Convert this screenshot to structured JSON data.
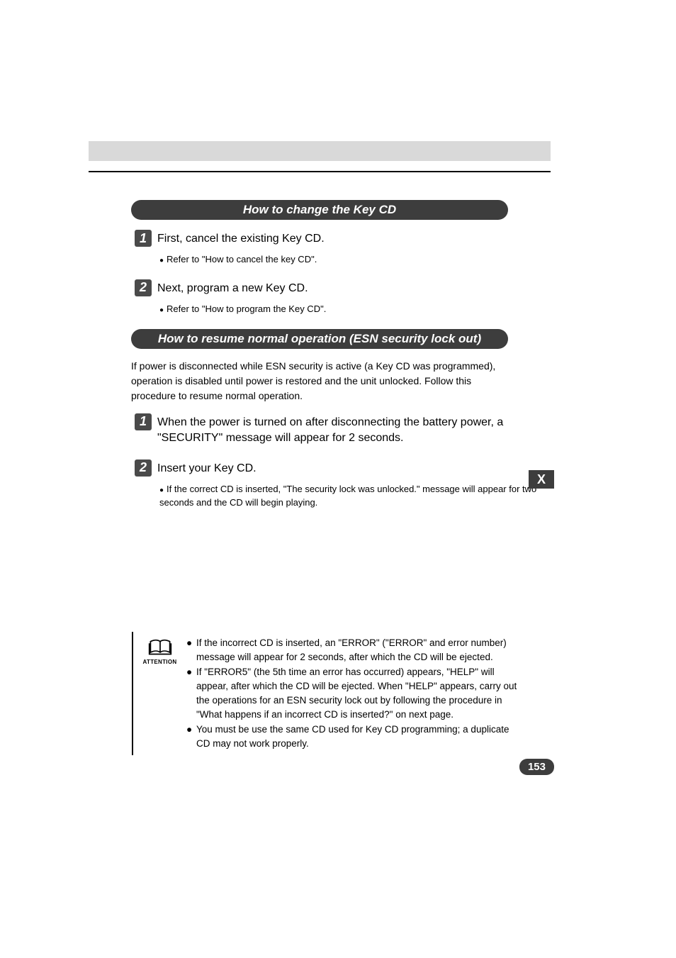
{
  "section1": {
    "header": "How to change the Key CD",
    "step1": {
      "num": "1",
      "text": "First, cancel the existing Key CD.",
      "sub": "Refer to \"How to cancel the key CD\"."
    },
    "step2": {
      "num": "2",
      "text": "Next, program a new Key CD.",
      "sub": "Refer to \"How to program the Key CD\"."
    }
  },
  "section2": {
    "header": "How to resume normal operation (ESN security lock out)",
    "intro": "If power is disconnected while ESN security is active (a Key CD was programmed), operation is disabled until power is restored and the unit unlocked. Follow this procedure to resume normal operation.",
    "step1": {
      "num": "1",
      "text": "When the power is turned on after disconnecting the battery power, a \"SECURITY\" message will appear for 2 seconds."
    },
    "step2": {
      "num": "2",
      "text": "Insert your Key CD.",
      "sub": "If the correct CD is inserted, \"The security lock was unlocked.\" message will appear for two seconds and the CD will begin playing."
    }
  },
  "tab": "X",
  "attention": {
    "label": "ATTENTION",
    "items": [
      "If the incorrect CD is inserted, an \"ERROR\" (\"ERROR\" and error number) message will appear for 2 seconds, after which the CD will be ejected.",
      "If \"ERROR5\" (the 5th time an error has occurred) appears, \"HELP\" will appear, after which the CD will be ejected. When \"HELP\" appears, carry out the operations for an ESN security lock out by following the procedure in \"What happens if an incorrect CD is inserted?\" on next page.",
      "You must be use the same CD used for Key CD programming; a duplicate CD may not work properly."
    ]
  },
  "page_number": "153"
}
